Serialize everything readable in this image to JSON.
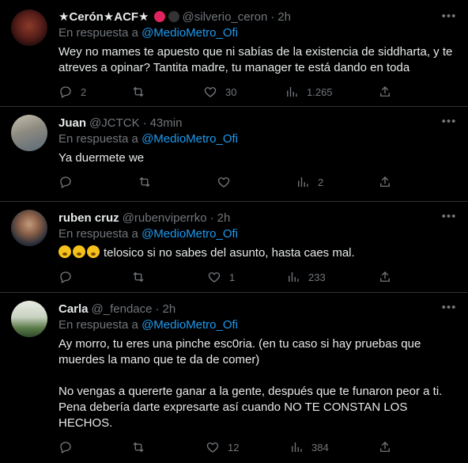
{
  "tweets": [
    {
      "name": "★Cerón★ACF★",
      "handle": "@silverio_ceron",
      "time": "2h",
      "reply_prefix": "En respuesta a",
      "reply_to": "@MedioMetro_Ofi",
      "text": "Wey no mames te apuesto que ni sabías de la existencia de siddharta, y te atreves a opinar? Tantita madre, tu manager te está dando en toda",
      "replies": "2",
      "retweets": "",
      "likes": "30",
      "views": "1.265"
    },
    {
      "name": "Juan",
      "handle": "@JCTCK",
      "time": "43min",
      "reply_prefix": "En respuesta a",
      "reply_to": "@MedioMetro_Ofi",
      "text": "Ya duermete we",
      "replies": "",
      "retweets": "",
      "likes": "",
      "views": "2"
    },
    {
      "name": "ruben cruz",
      "handle": "@rubenviperrko",
      "time": "2h",
      "reply_prefix": "En respuesta a",
      "reply_to": "@MedioMetro_Ofi",
      "text": "telosico si no sabes del asunto, hasta caes mal.",
      "replies": "",
      "retweets": "",
      "likes": "1",
      "views": "233"
    },
    {
      "name": "Carla",
      "handle": "@_fendace",
      "time": "2h",
      "reply_prefix": "En respuesta a",
      "reply_to": "@MedioMetro_Ofi",
      "text": "Ay morro, tu eres una pinche esc0ria. (en tu caso si hay pruebas que muerdes la mano que te da de comer)\n\nNo vengas a quererte ganar a la gente, después que te funaron peor a ti. Pena debería darte expresarte así cuando NO TE CONSTAN LOS HECHOS.",
      "replies": "",
      "retweets": "",
      "likes": "12",
      "views": "384"
    }
  ],
  "colors": {
    "background": "#000000",
    "text": "#e7e9ea",
    "muted": "#71767b",
    "link": "#1d9bf0",
    "divider": "#2f3336"
  },
  "icons": [
    "reply-icon",
    "retweet-icon",
    "like-icon",
    "views-icon",
    "share-icon",
    "more-icon"
  ]
}
